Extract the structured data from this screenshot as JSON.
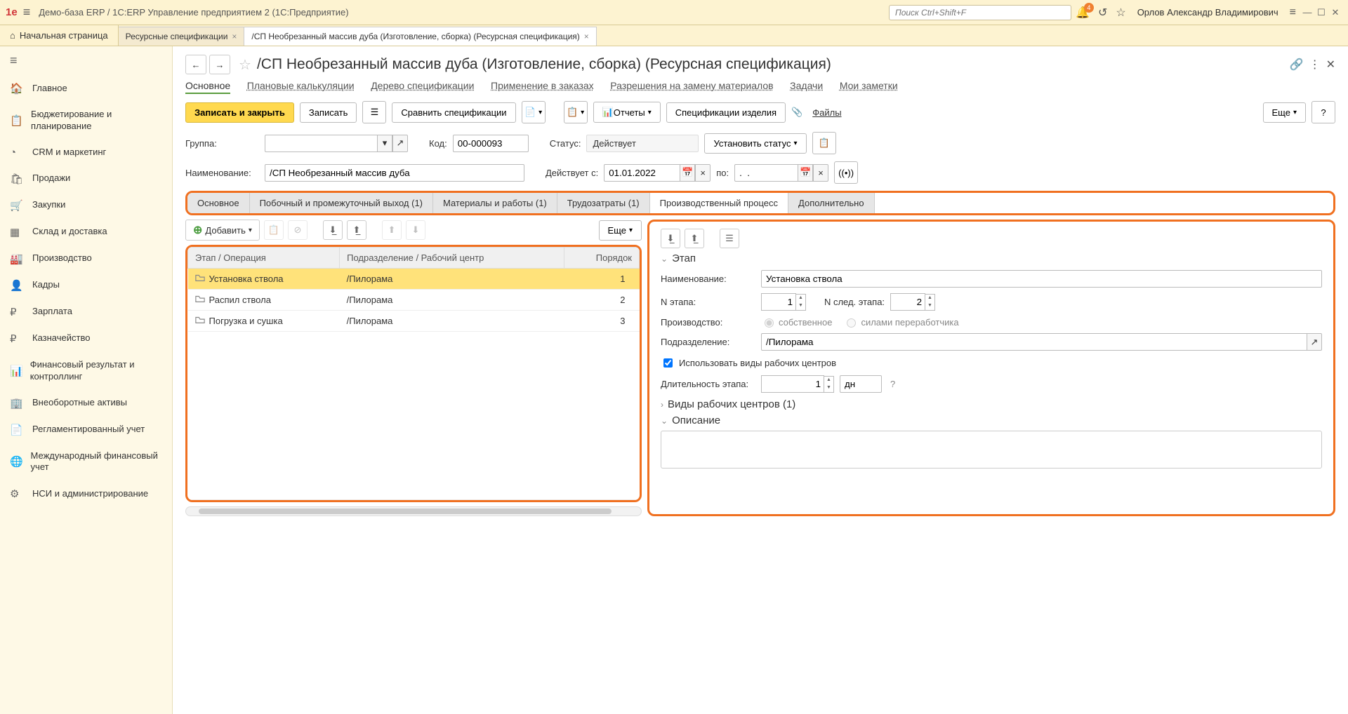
{
  "topbar": {
    "app_title": "Демо-база ERP / 1C:ERP Управление предприятием 2  (1С:Предприятие)",
    "search_placeholder": "Поиск Ctrl+Shift+F",
    "bell_count": "4",
    "user": "Орлов Александр Владимирович"
  },
  "tabs": {
    "home": "Начальная страница",
    "t1": "Ресурсные спецификации",
    "t2": "/СП Необрезанный массив дуба (Изготовление, сборка) (Ресурсная спецификация)"
  },
  "sidebar": [
    {
      "icon": "🏠",
      "label": "Главное"
    },
    {
      "icon": "📋",
      "label": "Бюджетирование и планирование"
    },
    {
      "icon": "◔",
      "label": "CRM и маркетинг"
    },
    {
      "icon": "🛍",
      "label": "Продажи"
    },
    {
      "icon": "🛒",
      "label": "Закупки"
    },
    {
      "icon": "▦",
      "label": "Склад и доставка"
    },
    {
      "icon": "🏭",
      "label": "Производство"
    },
    {
      "icon": "👤",
      "label": "Кадры"
    },
    {
      "icon": "₽",
      "label": "Зарплата"
    },
    {
      "icon": "₽",
      "label": "Казначейство"
    },
    {
      "icon": "📊",
      "label": "Финансовый результат и контроллинг"
    },
    {
      "icon": "🏢",
      "label": "Внеоборотные активы"
    },
    {
      "icon": "📄",
      "label": "Регламентированный учет"
    },
    {
      "icon": "🌐",
      "label": "Международный финансовый учет"
    },
    {
      "icon": "⚙",
      "label": "НСИ и администрирование"
    }
  ],
  "page": {
    "title": "/СП Необрезанный массив дуба (Изготовление, сборка) (Ресурсная спецификация)"
  },
  "sections": [
    "Основное",
    "Плановые калькуляции",
    "Дерево спецификации",
    "Применение в заказах",
    "Разрешения на замену материалов",
    "Задачи",
    "Мои заметки"
  ],
  "toolbar": {
    "save_close": "Записать и закрыть",
    "save": "Записать",
    "compare": "Сравнить спецификации",
    "reports": "Отчеты",
    "spec_items": "Спецификации изделия",
    "files": "Файлы",
    "more": "Еще"
  },
  "form": {
    "group_lbl": "Группа:",
    "code_lbl": "Код:",
    "code_val": "00-000093",
    "status_lbl": "Статус:",
    "status_val": "Действует",
    "set_status": "Установить статус",
    "name_lbl": "Наименование:",
    "name_val": "/СП Необрезанный массив дуба",
    "valid_from_lbl": "Действует с:",
    "valid_from": "01.01.2022",
    "to_lbl": "по:",
    "to_val": ".  ."
  },
  "dtabs": [
    "Основное",
    "Побочный и промежуточный выход (1)",
    "Материалы и работы (1)",
    "Трудозатраты (1)",
    "Производственный процесс",
    "Дополнительно"
  ],
  "gridbar": {
    "add": "Добавить",
    "more": "Еще"
  },
  "grid": {
    "cols": [
      "Этап / Операция",
      "Подразделение / Рабочий центр",
      "Порядок"
    ],
    "rows": [
      {
        "op": "Установка ствола",
        "dep": "/Пилорама",
        "ord": "1"
      },
      {
        "op": "Распил ствола",
        "dep": "/Пилорама",
        "ord": "2"
      },
      {
        "op": "Погрузка и сушка",
        "dep": "/Пилорама",
        "ord": "3"
      }
    ]
  },
  "stage": {
    "hdr": "Этап",
    "name_lbl": "Наименование:",
    "name_val": "Установка ствола",
    "num_lbl": "N этапа:",
    "num_val": "1",
    "next_lbl": "N след. этапа:",
    "next_val": "2",
    "prod_lbl": "Производство:",
    "own": "собственное",
    "outsrc": "силами переработчика",
    "dept_lbl": "Подразделение:",
    "dept_val": "/Пилорама",
    "use_wc": "Использовать виды рабочих центров",
    "dur_lbl": "Длительность этапа:",
    "dur_val": "1",
    "dur_unit": "дн",
    "wc_hdr": "Виды рабочих центров (1)",
    "desc_hdr": "Описание"
  }
}
